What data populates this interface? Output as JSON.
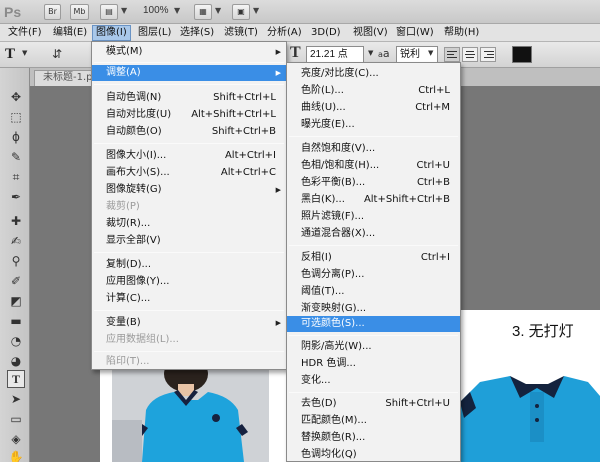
{
  "titlebar": {
    "logo": "Ps",
    "btn_br": "Br",
    "btn_mb": "Mb",
    "zoom": "100%"
  },
  "menubar": {
    "items": [
      "文件(F)",
      "编辑(E)",
      "图像(I)",
      "图层(L)",
      "选择(S)",
      "滤镜(T)",
      "分析(A)",
      "3D(D)",
      "视图(V)",
      "窗口(W)",
      "帮助(H)"
    ]
  },
  "options": {
    "font_size": "21.21 点",
    "aa_label": "a",
    "aa_value": "锐利",
    "text_color": "#111111"
  },
  "document": {
    "tab_title": "未标题-1.ps",
    "caption": "3. 无打灯"
  },
  "image_menu": {
    "items": [
      {
        "label": "模式(M)",
        "shortcut": "",
        "submenu": true,
        "disabled": false
      },
      {
        "label": "调整(A)",
        "shortcut": "",
        "submenu": true,
        "disabled": false,
        "highlighted": true
      },
      {
        "label": "自动色调(N)",
        "shortcut": "Shift+Ctrl+L",
        "submenu": false,
        "disabled": false
      },
      {
        "label": "自动对比度(U)",
        "shortcut": "Alt+Shift+Ctrl+L",
        "submenu": false,
        "disabled": false
      },
      {
        "label": "自动颜色(O)",
        "shortcut": "Shift+Ctrl+B",
        "submenu": false,
        "disabled": false
      },
      {
        "label": "图像大小(I)...",
        "shortcut": "Alt+Ctrl+I",
        "submenu": false,
        "disabled": false
      },
      {
        "label": "画布大小(S)...",
        "shortcut": "Alt+Ctrl+C",
        "submenu": false,
        "disabled": false
      },
      {
        "label": "图像旋转(G)",
        "shortcut": "",
        "submenu": true,
        "disabled": false
      },
      {
        "label": "裁剪(P)",
        "shortcut": "",
        "submenu": false,
        "disabled": true
      },
      {
        "label": "裁切(R)...",
        "shortcut": "",
        "submenu": false,
        "disabled": false
      },
      {
        "label": "显示全部(V)",
        "shortcut": "",
        "submenu": false,
        "disabled": false
      },
      {
        "label": "复制(D)...",
        "shortcut": "",
        "submenu": false,
        "disabled": false
      },
      {
        "label": "应用图像(Y)...",
        "shortcut": "",
        "submenu": false,
        "disabled": false
      },
      {
        "label": "计算(C)...",
        "shortcut": "",
        "submenu": false,
        "disabled": false
      },
      {
        "label": "变量(B)",
        "shortcut": "",
        "submenu": true,
        "disabled": false
      },
      {
        "label": "应用数据组(L)...",
        "shortcut": "",
        "submenu": false,
        "disabled": true
      },
      {
        "label": "陷印(T)...",
        "shortcut": "",
        "submenu": false,
        "disabled": true
      }
    ]
  },
  "adjust_menu": {
    "items": [
      {
        "label": "亮度/对比度(C)...",
        "shortcut": ""
      },
      {
        "label": "色阶(L)...",
        "shortcut": "Ctrl+L"
      },
      {
        "label": "曲线(U)...",
        "shortcut": "Ctrl+M"
      },
      {
        "label": "曝光度(E)...",
        "shortcut": ""
      },
      {
        "label": "自然饱和度(V)...",
        "shortcut": ""
      },
      {
        "label": "色相/饱和度(H)...",
        "shortcut": "Ctrl+U"
      },
      {
        "label": "色彩平衡(B)...",
        "shortcut": "Ctrl+B"
      },
      {
        "label": "黑白(K)...",
        "shortcut": "Alt+Shift+Ctrl+B"
      },
      {
        "label": "照片滤镜(F)...",
        "shortcut": ""
      },
      {
        "label": "通道混合器(X)...",
        "shortcut": ""
      },
      {
        "label": "反相(I)",
        "shortcut": "Ctrl+I"
      },
      {
        "label": "色调分离(P)...",
        "shortcut": ""
      },
      {
        "label": "阈值(T)...",
        "shortcut": ""
      },
      {
        "label": "渐变映射(G)...",
        "shortcut": ""
      },
      {
        "label": "可选颜色(S)...",
        "shortcut": "",
        "highlighted": true
      },
      {
        "label": "阴影/高光(W)...",
        "shortcut": ""
      },
      {
        "label": "HDR 色调...",
        "shortcut": ""
      },
      {
        "label": "变化...",
        "shortcut": ""
      },
      {
        "label": "去色(D)",
        "shortcut": "Shift+Ctrl+U"
      },
      {
        "label": "匹配颜色(M)...",
        "shortcut": ""
      },
      {
        "label": "替换颜色(R)...",
        "shortcut": ""
      },
      {
        "label": "色调均化(Q)",
        "shortcut": ""
      }
    ]
  }
}
